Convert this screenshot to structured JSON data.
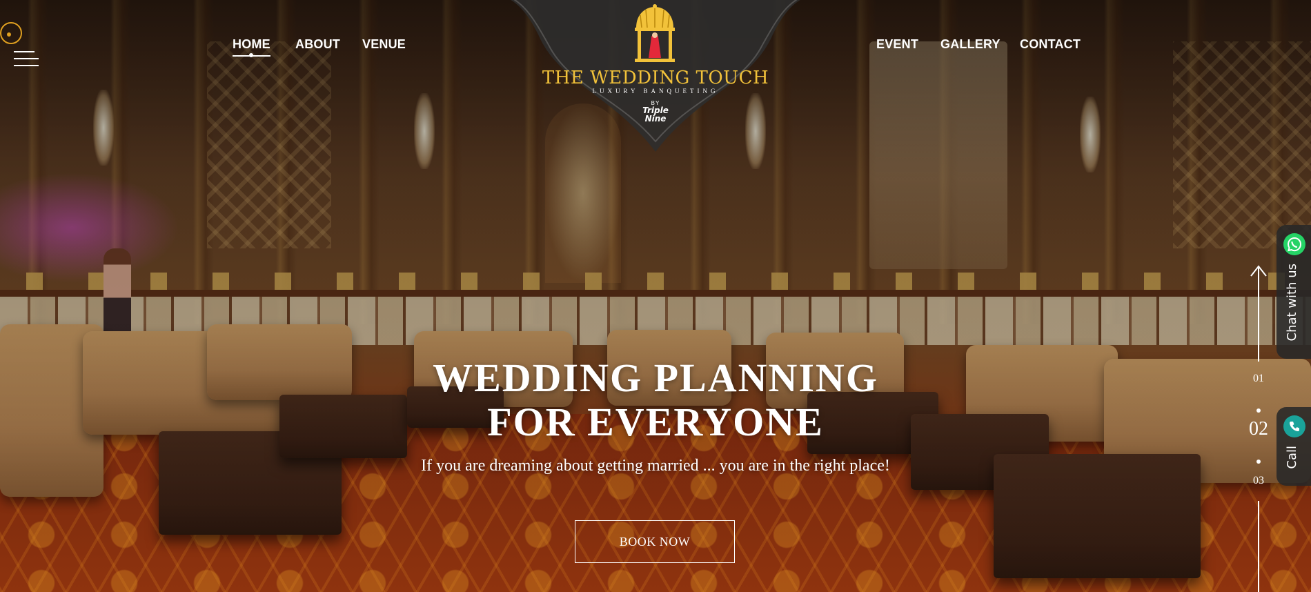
{
  "nav": {
    "left": [
      "HOME",
      "ABOUT",
      "VENUE"
    ],
    "right": [
      "EVENT",
      "GALLERY",
      "CONTACT"
    ],
    "active": "HOME"
  },
  "logo": {
    "title": "THE WEDDING TOUCH",
    "subtitle": "LUXURY BANQUETING",
    "by": "BY",
    "brand_line1": "Triple",
    "brand_line2": "Nine"
  },
  "hero": {
    "title_line1": "WEDDING PLANNING",
    "title_line2": "FOR EVERYONE",
    "subtitle": "If you are dreaming about getting married ... you are in the right place!",
    "cta": "BOOK NOW"
  },
  "slider": {
    "prev": "01",
    "current": "02",
    "next": "03"
  },
  "floating": {
    "whatsapp_label": "Chat with us",
    "call_label": "Call"
  },
  "colors": {
    "accent_gold": "#f2c23a",
    "ring_gold": "#e0a020",
    "whatsapp_green": "#25d366",
    "call_teal": "#1aa39a",
    "text": "#ffffff"
  },
  "icons": [
    "menu-icon",
    "indicator-dot-icon",
    "whatsapp-icon",
    "phone-icon",
    "arrow-up-icon",
    "pavilion-logo-icon"
  ]
}
